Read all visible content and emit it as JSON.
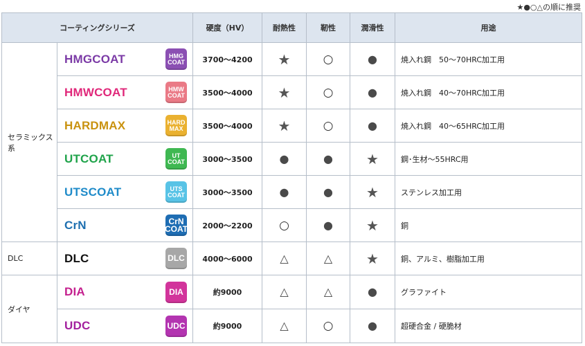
{
  "legend": "★●○△の順に推奨",
  "headers": {
    "series": "コーティングシリーズ",
    "hardness": "硬度（HV）",
    "heat": "耐熱性",
    "toughness": "靭性",
    "lubricity": "潤滑性",
    "usage": "用途"
  },
  "groups": {
    "ceramic": "セラミックス系",
    "dlc": "DLC",
    "diamond": "ダイヤ"
  },
  "rows": [
    {
      "name": "HMGCOAT",
      "badge_l1": "HMG",
      "badge_l2": "COAT",
      "hardness": "3700～4200",
      "heat": "★",
      "toughness": "○",
      "lubricity": "●",
      "usage": "焼入れ鋼　50～70HRC加工用",
      "name_color": "#7b3aa6",
      "badge_color": "#8b4fb3"
    },
    {
      "name": "HMWCOAT",
      "badge_l1": "HMW",
      "badge_l2": "COAT",
      "hardness": "3500～4000",
      "heat": "★",
      "toughness": "○",
      "lubricity": "●",
      "usage": "焼入れ鋼　40～70HRC加工用",
      "name_color": "#e0287a",
      "badge_color": "#ea7a86"
    },
    {
      "name": "HARDMAX",
      "badge_l1": "HARD",
      "badge_l2": "MAX",
      "hardness": "3500～4000",
      "heat": "★",
      "toughness": "○",
      "lubricity": "●",
      "usage": "焼入れ鋼　40～65HRC加工用",
      "name_color": "#c9920f",
      "badge_color": "#eab130"
    },
    {
      "name": "UTCOAT",
      "badge_l1": "UT",
      "badge_l2": "COAT",
      "hardness": "3000～3500",
      "heat": "●",
      "toughness": "●",
      "lubricity": "★",
      "usage": "鋼･生材～55HRC用",
      "name_color": "#1fa34a",
      "badge_color": "#3fb852"
    },
    {
      "name": "UTSCOAT",
      "badge_l1": "UTS",
      "badge_l2": "COAT",
      "hardness": "3000～3500",
      "heat": "●",
      "toughness": "●",
      "lubricity": "★",
      "usage": "ステンレス加工用",
      "name_color": "#1f8bc9",
      "badge_color": "#58c3e6"
    },
    {
      "name": "CrN",
      "badge_l1": "CrN",
      "badge_l2": "COAT",
      "hardness": "2000～2200",
      "heat": "○",
      "toughness": "●",
      "lubricity": "★",
      "usage": "銅",
      "name_color": "#1d6fb0",
      "badge_color": "#1e6db3"
    },
    {
      "name": "DLC",
      "badge_l1": "DLC",
      "badge_l2": "",
      "hardness": "4000～6000",
      "heat": "△",
      "toughness": "△",
      "lubricity": "★",
      "usage": "銅、アルミ、樹脂加工用",
      "name_color": "#111111",
      "badge_color": "#a7a7a7"
    },
    {
      "name": "DIA",
      "badge_l1": "DIA",
      "badge_l2": "",
      "hardness": "約9000",
      "heat": "△",
      "toughness": "△",
      "lubricity": "●",
      "usage": "グラファイト",
      "name_color": "#c4208e",
      "badge_color": "#d2349b"
    },
    {
      "name": "UDC",
      "badge_l1": "UDC",
      "badge_l2": "",
      "hardness": "約9000",
      "heat": "△",
      "toughness": "○",
      "lubricity": "●",
      "usage": "超硬合金 / 硬脆材",
      "name_color": "#a3209e",
      "badge_color": "#b334b0"
    }
  ]
}
